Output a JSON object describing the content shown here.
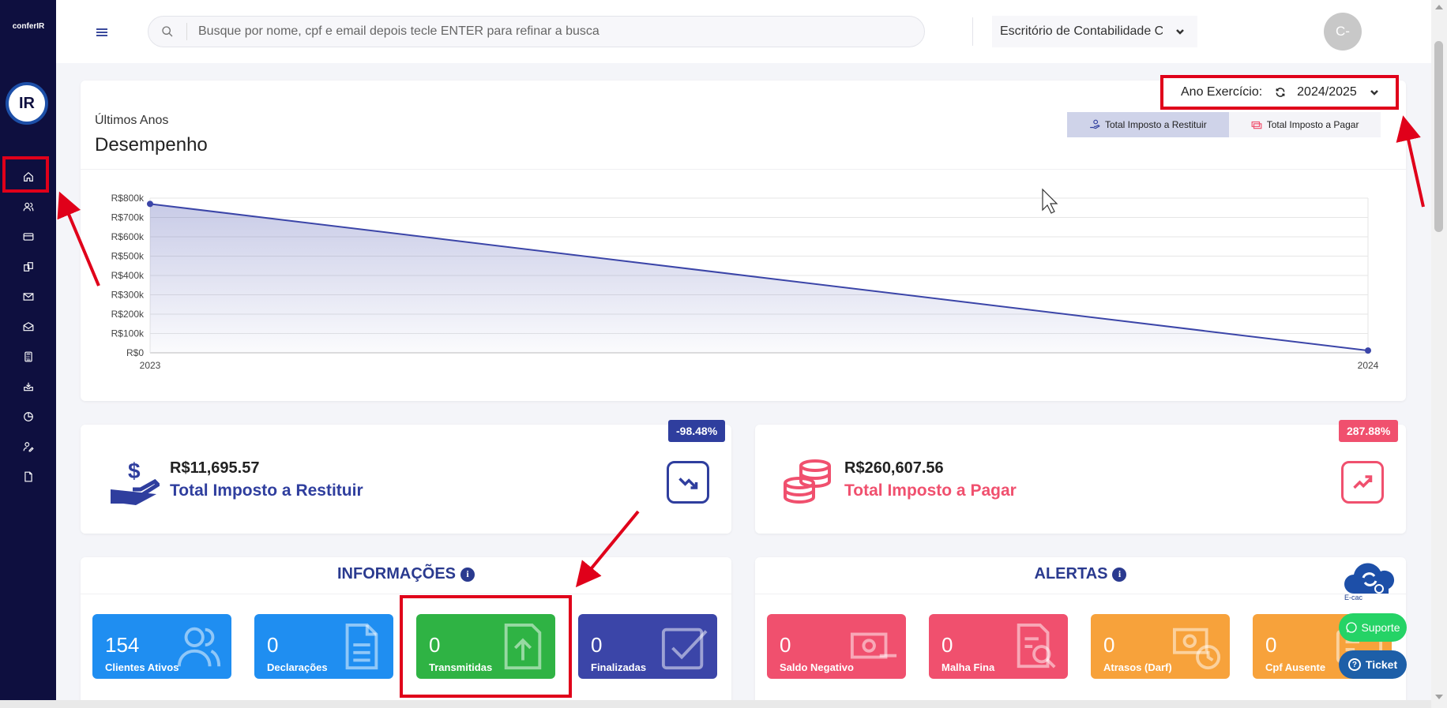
{
  "sidebar": {
    "logo_small": "conferIR",
    "logo_big": "IR",
    "items": [
      "home",
      "users",
      "card",
      "documents",
      "mail",
      "mail-open",
      "calculator",
      "inbox",
      "pie-chart",
      "user-edit",
      "file"
    ]
  },
  "topbar": {
    "search_placeholder": "Busque por nome, cpf e email depois tecle ENTER para refinar a busca",
    "office_selected": "Escritório de Contabilidade Co",
    "avatar_initials": "C-"
  },
  "performance": {
    "subtitle": "Últimos Anos",
    "title": "Desempenho",
    "year_label": "Ano Exercício:",
    "year_value": "2024/2025",
    "toggle_restituir": "Total Imposto a Restituir",
    "toggle_pagar": "Total Imposto a Pagar"
  },
  "chart_data": {
    "type": "area",
    "x": [
      "2023",
      "2024"
    ],
    "series": [
      {
        "values": [
          770000,
          11695.57
        ]
      }
    ],
    "y_ticks": [
      "R$0",
      "R$100k",
      "R$200k",
      "R$300k",
      "R$400k",
      "R$500k",
      "R$600k",
      "R$700k",
      "R$800k"
    ],
    "ylim": [
      0,
      800000
    ],
    "grid": true,
    "color": "#3b45a8"
  },
  "kpis": {
    "restituir": {
      "value": "R$11,695.57",
      "label": "Total Imposto a Restituir",
      "badge": "-98.48%",
      "color": "#2f3e9e"
    },
    "pagar": {
      "value": "R$260,607.56",
      "label": "Total Imposto a Pagar",
      "badge": "287.88%",
      "color": "#f0506e"
    }
  },
  "informacoes": {
    "title": "INFORMAÇÕES",
    "info_glyph": "i",
    "tiles": [
      {
        "num": "154",
        "label": "Clientes Ativos",
        "color": "#1f8ef1"
      },
      {
        "num": "0",
        "label": "Declarações",
        "color": "#1f8ef1"
      },
      {
        "num": "0",
        "label": "Transmitidas",
        "color": "#2fb344"
      },
      {
        "num": "0",
        "label": "Finalizadas",
        "color": "#3b45a8"
      }
    ]
  },
  "alertas": {
    "title": "ALERTAS",
    "info_glyph": "i",
    "tiles": [
      {
        "num": "0",
        "label": "Saldo Negativo",
        "color": "#f0506e"
      },
      {
        "num": "0",
        "label": "Malha Fina",
        "color": "#f0506e"
      },
      {
        "num": "0",
        "label": "Atrasos (Darf)",
        "color": "#f7a23b"
      },
      {
        "num": "0",
        "label": "Cpf Ausente",
        "color": "#f7a23b"
      }
    ]
  },
  "floating": {
    "ecac": "E-cac",
    "suporte": "Suporte",
    "ticket": "Ticket",
    "ticket_glyph": "?"
  }
}
